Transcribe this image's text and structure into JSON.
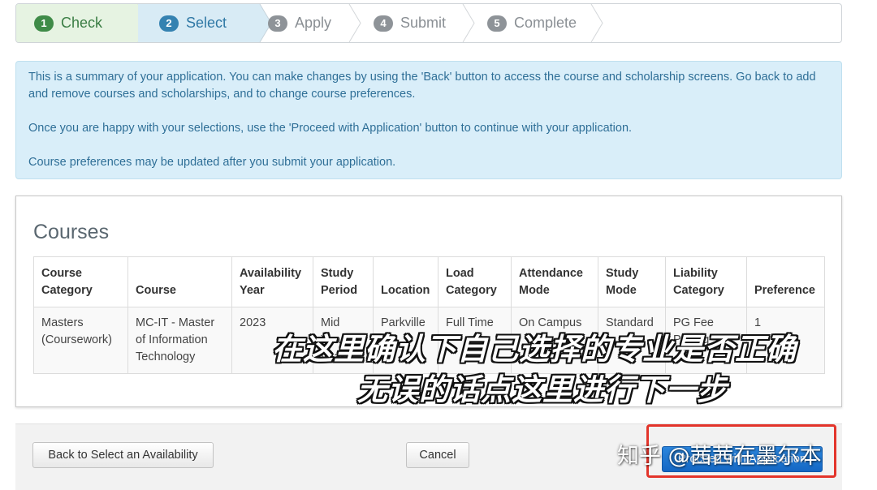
{
  "stepper": {
    "steps": [
      {
        "number": "1",
        "label": "Check",
        "state": "done"
      },
      {
        "number": "2",
        "label": "Select",
        "state": "active"
      },
      {
        "number": "3",
        "label": "Apply",
        "state": "pending"
      },
      {
        "number": "4",
        "label": "Submit",
        "state": "pending"
      },
      {
        "number": "5",
        "label": "Complete",
        "state": "pending"
      }
    ]
  },
  "info": {
    "p1": "This is a summary of your application. You can make changes by using the 'Back' button to access the course and scholarship screens. Go back to add and remove courses and scholarships, and to change course preferences.",
    "p2": "Once you are happy with your selections, use the 'Proceed with Application' button to continue with your application.",
    "p3": "Course preferences may be updated after you submit your application."
  },
  "courses": {
    "title": "Courses",
    "headers": [
      "Course Category",
      "Course",
      "Availability Year",
      "Study Period",
      "Location",
      "Load Category",
      "Attendance Mode",
      "Study Mode",
      "Liability Category",
      "Preference"
    ],
    "rows": [
      [
        "Masters (Coursework)",
        "MC-IT - Master of Information Technology",
        "2023",
        "Mid Year Intake",
        "Parkville",
        "Full Time",
        "On Campus",
        "Standard",
        "PG Fee Paying",
        "1"
      ]
    ]
  },
  "footer": {
    "back_label": "Back to Select an Availability",
    "cancel_label": "Cancel",
    "proceed_label": "Proceed with Application"
  },
  "overlay": {
    "caption_line1": "在这里确认下自己选择的专业是否正确",
    "caption_line2": "无误的话点这里进行下一步",
    "watermark": "知乎 @茜茜在墨尔本"
  },
  "colors": {
    "done": "#3f8b48",
    "active": "#3582b1",
    "info_bg": "#d9eef9",
    "proceed": "#1a6fd0",
    "highlight": "#e3352b"
  }
}
